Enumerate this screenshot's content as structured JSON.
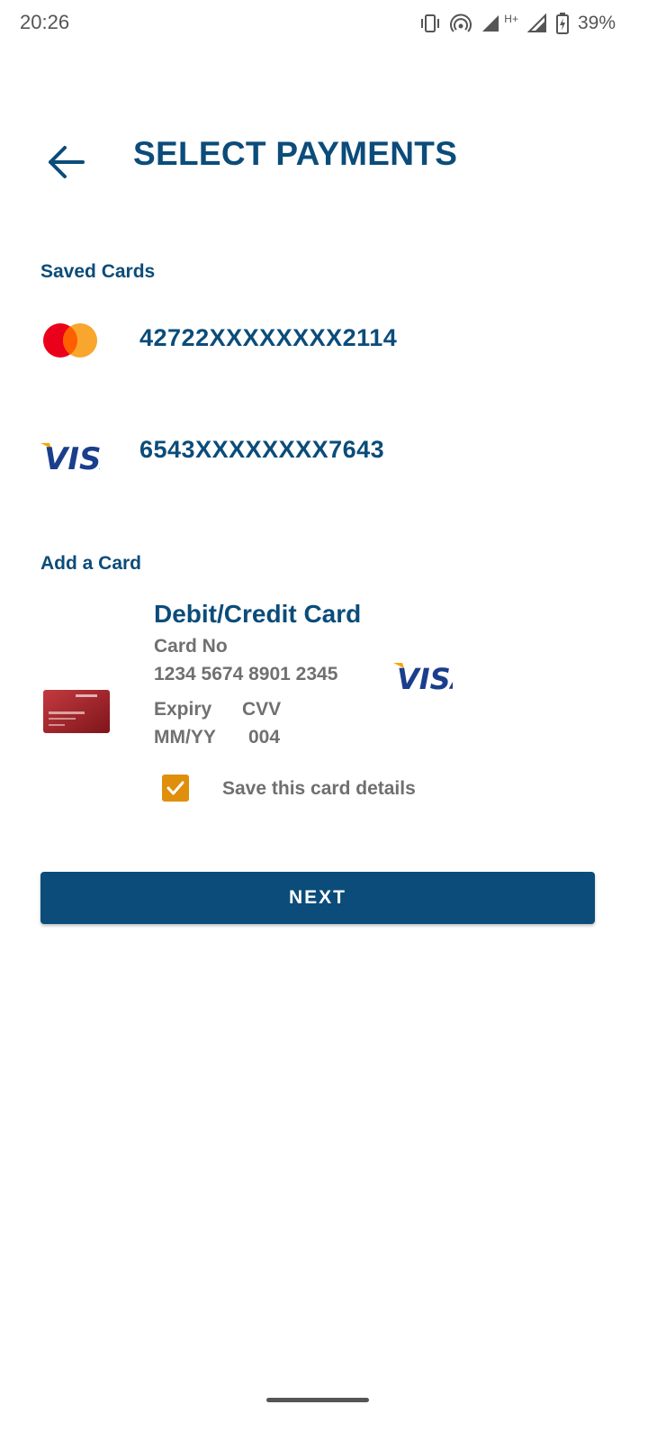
{
  "status_bar": {
    "time": "20:26",
    "battery": "39%",
    "network_label": "H+",
    "icons": [
      "vibrate-icon",
      "hotspot-icon",
      "signal-icon",
      "signal-icon",
      "battery-charging-icon"
    ]
  },
  "header": {
    "title": "SELECT PAYMENTS",
    "back_icon": "arrow-left-icon"
  },
  "saved_cards": {
    "section_label": "Saved Cards",
    "items": [
      {
        "brand": "mastercard",
        "number": "42722XXXXXXXX2114"
      },
      {
        "brand": "visa",
        "number": "6543XXXXXXXX7643"
      }
    ]
  },
  "add_card": {
    "section_label": "Add a Card",
    "title": "Debit/Credit Card",
    "card_no_label": "Card No",
    "card_no_value": "1234 5674 8901 2345",
    "expiry_label": "Expiry",
    "cvv_label": "CVV",
    "expiry_value": "MM/YY",
    "cvv_value": "004",
    "brand": "visa",
    "save_label": "Save this card details",
    "save_checked": true
  },
  "actions": {
    "next_label": "NEXT"
  },
  "colors": {
    "primary": "#0b4c7a",
    "accent": "#e08f0c",
    "muted_text": "#707070"
  }
}
